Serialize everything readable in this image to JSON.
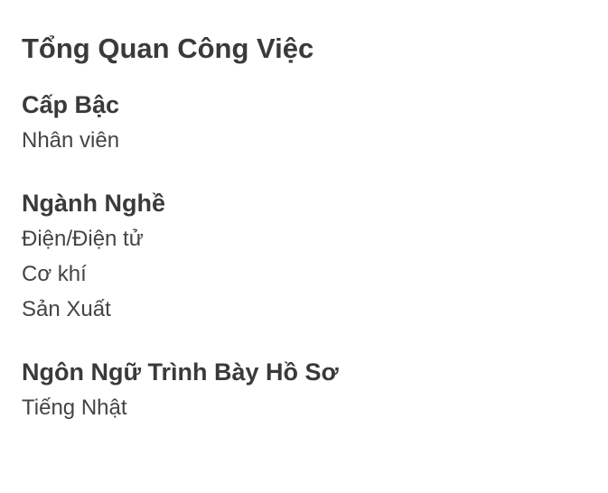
{
  "overview": {
    "title": "Tổng Quan Công Việc",
    "sections": [
      {
        "heading": "Cấp Bậc",
        "values": [
          "Nhân viên"
        ]
      },
      {
        "heading": "Ngành Nghề",
        "values": [
          "Điện/Điện tử",
          "Cơ khí",
          "Sản Xuất"
        ]
      },
      {
        "heading": "Ngôn Ngữ Trình Bày Hồ Sơ",
        "values": [
          "Tiếng Nhật"
        ]
      }
    ]
  },
  "colors": {
    "background": "#ffffff",
    "heading_text": "#3a3a3a",
    "body_text": "#444444"
  }
}
